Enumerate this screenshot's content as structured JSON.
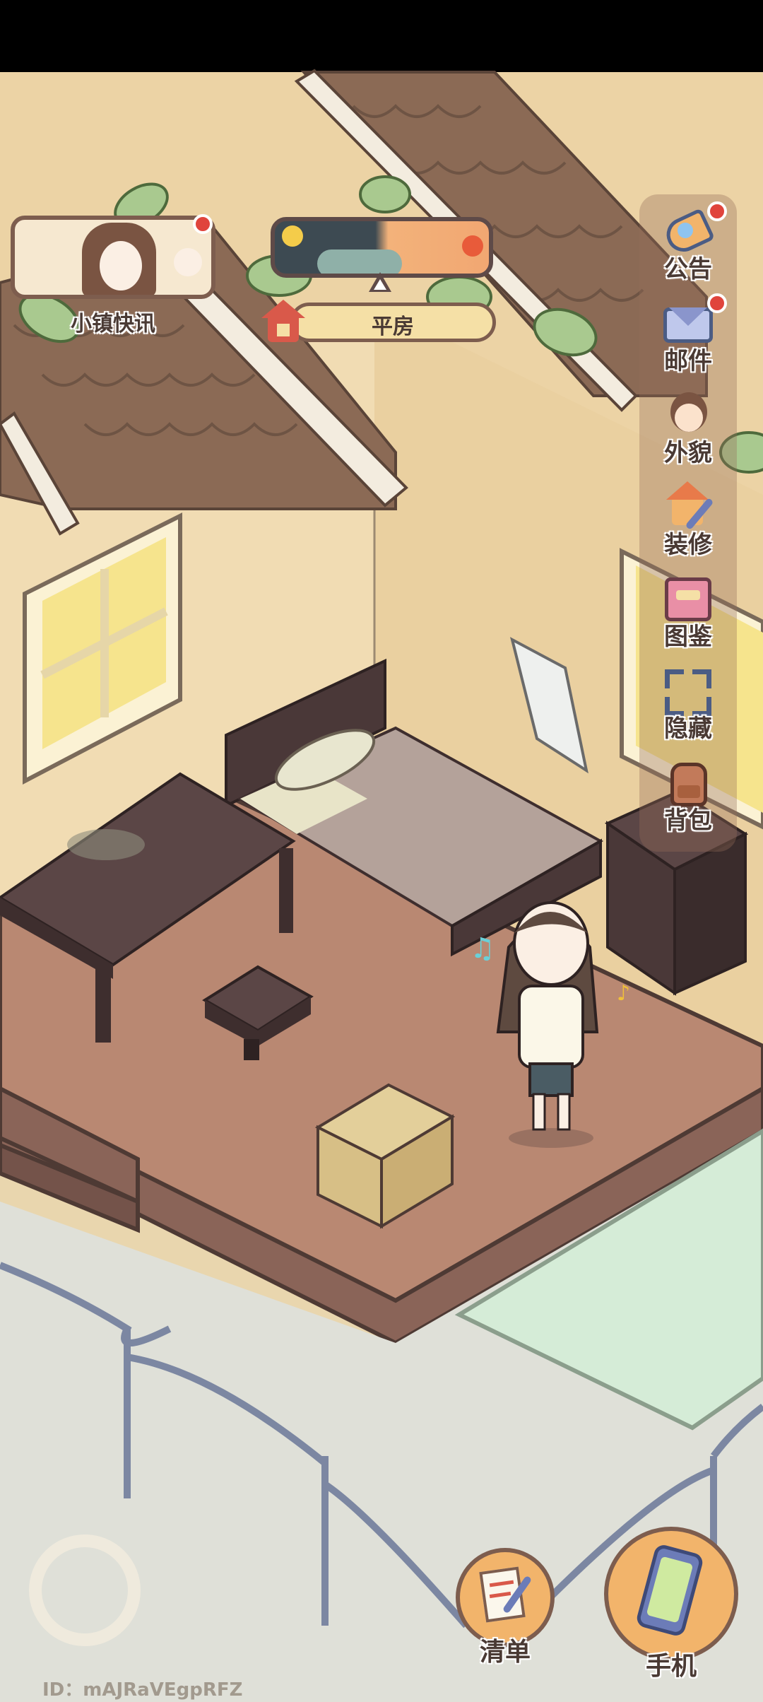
{
  "news_card": {
    "label": "小镇快讯",
    "has_notification": true
  },
  "time_bar": {
    "location_label": "平房"
  },
  "sidebar": {
    "items": [
      {
        "label": "公告",
        "icon": "megaphone-icon",
        "has_notification": true
      },
      {
        "label": "邮件",
        "icon": "mail-icon",
        "has_notification": true
      },
      {
        "label": "外貌",
        "icon": "character-face-icon",
        "has_notification": false
      },
      {
        "label": "装修",
        "icon": "house-wrench-icon",
        "has_notification": false
      },
      {
        "label": "图鉴",
        "icon": "book-icon",
        "has_notification": false
      },
      {
        "label": "隐藏",
        "icon": "hide-frame-icon",
        "has_notification": false
      },
      {
        "label": "背包",
        "icon": "backpack-icon",
        "has_notification": false
      }
    ]
  },
  "bottom_bar": {
    "list_label": "清单",
    "phone_label": "手机"
  },
  "player_id": "ID：mAJRaVEgpRFZ",
  "colors": {
    "accent": "#f2b46b",
    "notification": "#e0443c",
    "text": "#4a3a34"
  }
}
